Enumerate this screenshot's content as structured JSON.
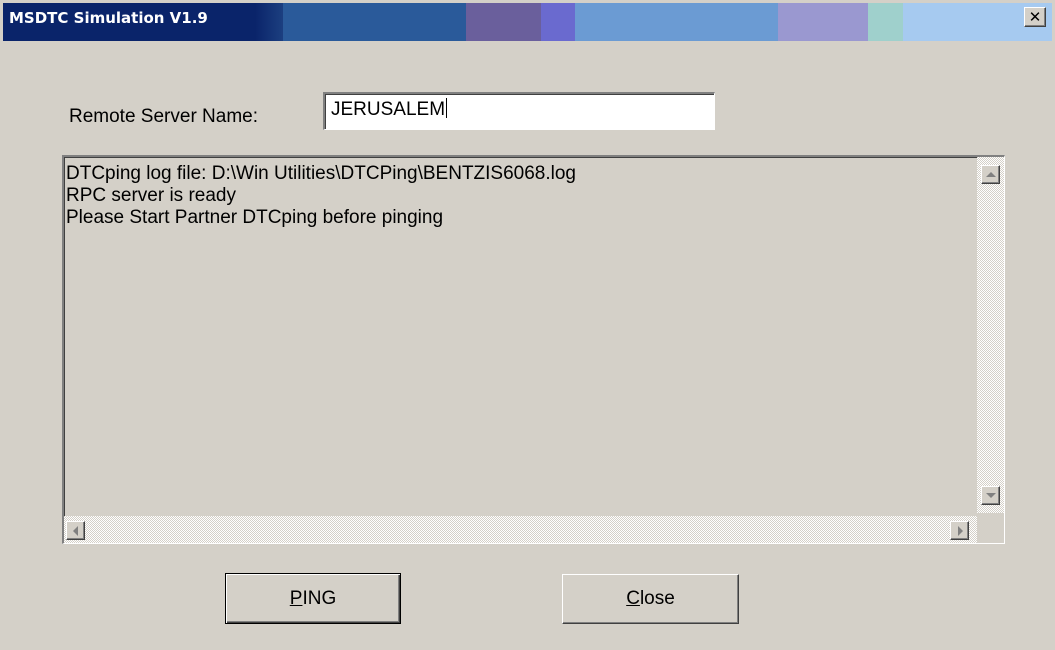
{
  "window": {
    "title": "MSDTC Simulation V1.9",
    "close_glyph": "✕",
    "titlebar_colors": [
      "#0a246a",
      "#2a5a9a",
      "#3e6ca8",
      "#6a5f9c",
      "#6a6acf",
      "#6b9bd3",
      "#7aa8df",
      "#9a98d0",
      "#9fd0cc",
      "#a6caf0"
    ]
  },
  "form": {
    "server_label": "Remote Server Name:",
    "server_value": "JERUSALEM"
  },
  "log": {
    "lines": [
      "DTCping log file: D:\\Win Utilities\\DTCPing\\BENTZIS6068.log",
      "RPC server is ready",
      "Please Start Partner DTCping before pinging"
    ]
  },
  "buttons": {
    "ping": {
      "mnemonic": "P",
      "rest": "ING"
    },
    "close": {
      "mnemonic": "C",
      "rest": "lose"
    }
  },
  "icons": {
    "close": "close-icon",
    "scroll_up": "scroll-up-arrow-icon",
    "scroll_down": "scroll-down-arrow-icon",
    "scroll_left": "scroll-left-arrow-icon",
    "scroll_right": "scroll-right-arrow-icon"
  }
}
